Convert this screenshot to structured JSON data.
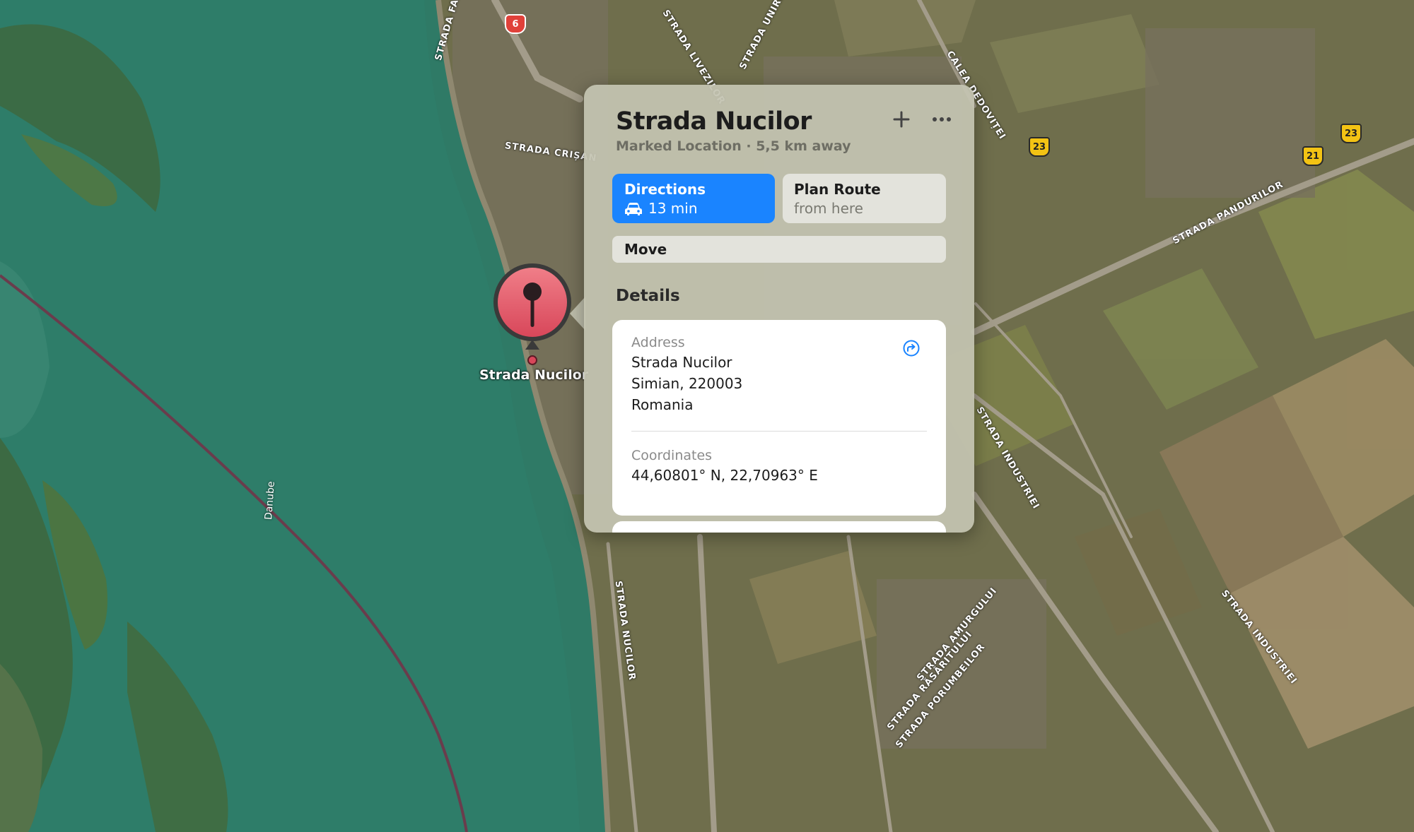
{
  "map": {
    "river_label": "Danube",
    "pin_label": "Strada Nucilor",
    "road_labels": [
      "STRADA FALEZEI",
      "STRADA LIVEZILOR",
      "STRADA UNIRII",
      "CALEA DEDOVIȚEI",
      "STRADA CRIȘAN",
      "STRADA PANDURILOR",
      "STRADA INDUSTRIEI",
      "STRADA NUCILOR",
      "STRADA AMURGULUI",
      "STRADA RĂSĂRITULUI",
      "STRADA PORUMBEILOR",
      "STRADA INDUSTRIEI"
    ],
    "route_shields": [
      "6",
      "23",
      "23",
      "21"
    ]
  },
  "card": {
    "title": "Strada Nucilor",
    "subtitle": "Marked Location · 5,5 km away",
    "add_icon": "plus-icon",
    "more_icon": "ellipsis-icon",
    "directions": {
      "label": "Directions",
      "time": "13 min",
      "icon": "car-icon",
      "color": "#1a84ff"
    },
    "plan_route": {
      "label": "Plan Route",
      "sub": "from here"
    },
    "move_label": "Move",
    "details_heading": "Details",
    "address": {
      "label": "Address",
      "line1": "Strada Nucilor",
      "line2": "Simian, 220003",
      "line3": "Romania",
      "share_icon": "share-arrow-icon"
    },
    "coordinates": {
      "label": "Coordinates",
      "value": "44,60801° N, 22,70963° E"
    }
  }
}
